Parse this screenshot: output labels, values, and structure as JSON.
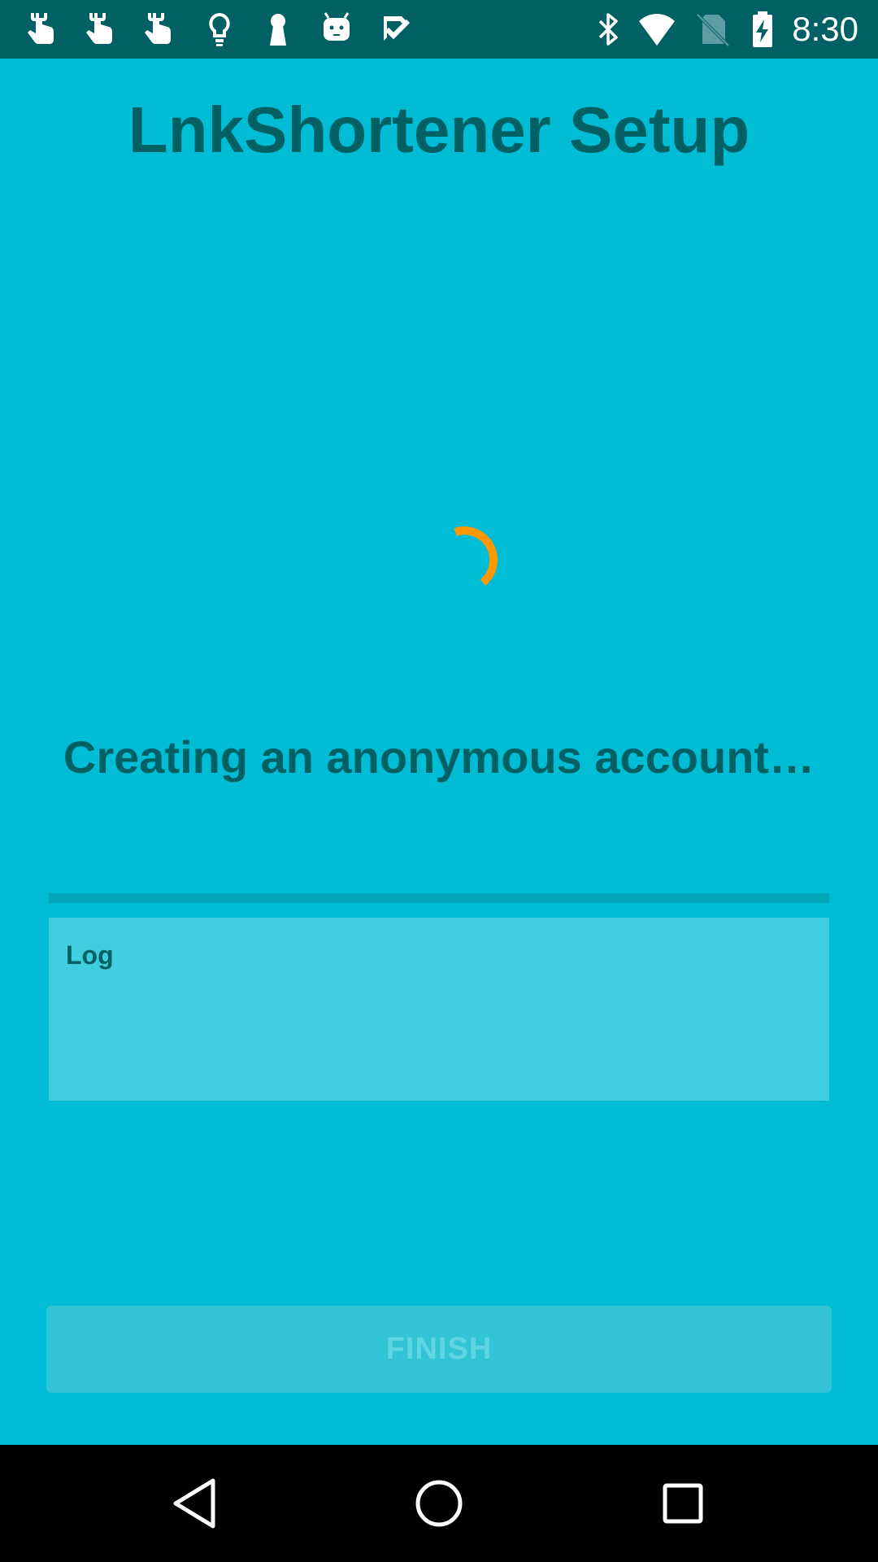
{
  "status_bar": {
    "time": "8:30",
    "left_icons": [
      "touch-icon",
      "touch-icon",
      "touch-icon",
      "lightbulb-icon",
      "keyhole-icon",
      "android-icon",
      "checkmark-icon"
    ],
    "right_icons": [
      "bluetooth-icon",
      "wifi-icon",
      "no-sim-icon",
      "battery-charging-icon"
    ]
  },
  "header": {
    "title": "LnkShortener Setup"
  },
  "progress": {
    "message": "Creating an anonymous account…",
    "spinner_color": "#ff9800",
    "bar_fraction": 0
  },
  "log": {
    "label": "Log",
    "content": ""
  },
  "actions": {
    "finish_label": "FINISH",
    "finish_enabled": false
  },
  "navigation": {
    "buttons": [
      "back-icon",
      "home-icon",
      "recents-icon"
    ]
  },
  "colors": {
    "background": "#00bcd4",
    "status_bar": "#006064",
    "text_primary": "#006064",
    "accent": "#ff9800",
    "log_background": "#40cde0",
    "button_disabled": "#33c3d6",
    "nav_bar": "#000000"
  }
}
